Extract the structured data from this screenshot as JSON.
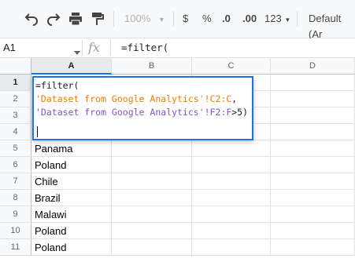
{
  "toolbar": {
    "undo_icon": "undo-icon",
    "redo_icon": "redo-icon",
    "print_icon": "print-icon",
    "paint_format_icon": "paint-format-icon",
    "zoom": "100%",
    "currency": "$",
    "percent": "%",
    "decrease_decimal": ".0",
    "increase_decimal": ".00",
    "more_formats": "123",
    "font": "Default (Ar"
  },
  "formula_bar": {
    "name_box": "A1",
    "fx": "fx",
    "content": "=filter("
  },
  "grid": {
    "columns": [
      "A",
      "B",
      "C",
      "D"
    ],
    "rows": [
      "1",
      "2",
      "3",
      "4",
      "5",
      "6",
      "7",
      "8",
      "9",
      "10",
      "11"
    ],
    "cells": [
      "",
      "",
      "",
      "",
      "Panama",
      "Poland",
      "Chile",
      "Brazil",
      "Malawi",
      "Poland",
      "Poland"
    ]
  },
  "editor": {
    "line1": "=filter(",
    "line2_range": "'Dataset from Google Analytics'!C2:C",
    "line2_sep": ",",
    "line3_range": "'Dataset from Google Analytics'!F2:F",
    "line3_rest": ">5)"
  },
  "colors": {
    "selection": "#1a73e8",
    "range1": "#f57c00",
    "range2": "#7e57c2"
  }
}
